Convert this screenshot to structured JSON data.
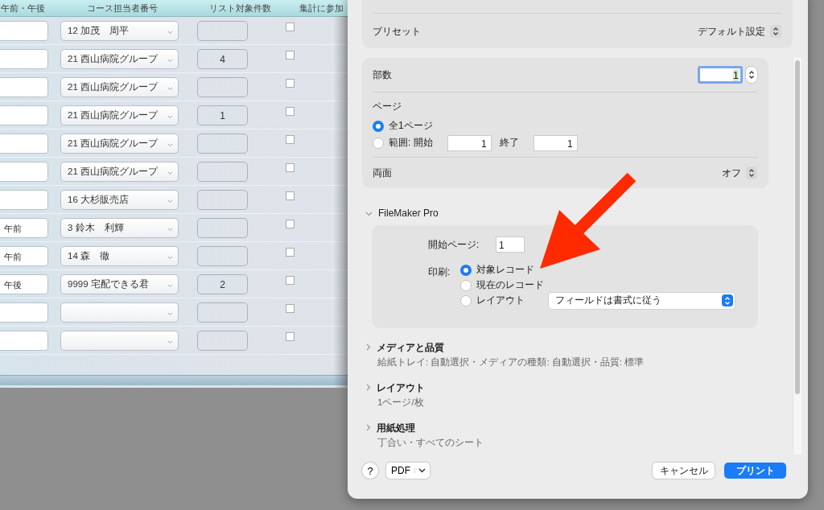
{
  "table": {
    "columns": [
      "午前・午後",
      "コース担当者番号",
      "リスト対象件数",
      "集計に参加"
    ],
    "rows": [
      {
        "course": "12 加茂　周平",
        "checked": false
      },
      {
        "course": "21 西山病院グループ",
        "count": "4",
        "checked": false
      },
      {
        "course": "21 西山病院グループ",
        "checked": false
      },
      {
        "course": "21 西山病院グループ",
        "count": "1",
        "checked": false
      },
      {
        "course": "21 西山病院グループ",
        "checked": false
      },
      {
        "course": "21 西山病院グループ",
        "checked": false
      },
      {
        "course": "16 大杉販売店",
        "checked": false
      },
      {
        "time": "午前",
        "course": "3 鈴木　利輝",
        "checked": false
      },
      {
        "time": "午前",
        "course": "14 森　徹",
        "checked": false
      },
      {
        "time": "午後",
        "course": "9999 宅配できる君",
        "count": "2",
        "checked": false
      },
      {
        "checked": false
      },
      {
        "checked": false
      }
    ]
  },
  "print_dialog": {
    "preset": {
      "label": "プリセット",
      "value": "デフォルト設定"
    },
    "copies": {
      "label": "部数",
      "value": "1"
    },
    "pages": {
      "label": "ページ",
      "options": [
        {
          "kind": "all",
          "label": "全1ページ",
          "selected": true
        },
        {
          "kind": "range",
          "label": "範囲: 開始",
          "from": "1",
          "to_label": "終了",
          "to": "1",
          "selected": false
        }
      ]
    },
    "duplex": {
      "label": "両面",
      "value": "オフ"
    },
    "filemaker": {
      "title": "FileMaker Pro",
      "expanded": true,
      "start_page_label": "開始ページ:",
      "start_page": "1",
      "print_label": "印刷:",
      "options": [
        {
          "label": "対象レコード",
          "selected": true
        },
        {
          "label": "現在のレコード",
          "selected": false
        },
        {
          "label": "レイアウト",
          "selected": false
        }
      ],
      "layout_dropdown": "フィールドは書式に従う"
    },
    "sections": [
      {
        "title": "メディアと品質",
        "summary": "給紙トレイ: 自動選択・メディアの種類: 自動選択・品質: 標準",
        "expanded": false
      },
      {
        "title": "レイアウト",
        "summary": "1ページ/枚",
        "expanded": false
      },
      {
        "title": "用紙処理",
        "summary": "丁合い・すべてのシート",
        "expanded": false
      }
    ],
    "help": "?",
    "pdf": "PDF",
    "buttons": [
      {
        "label": "キャンセル",
        "kind": "default"
      },
      {
        "label": "プリント",
        "kind": "primary"
      }
    ]
  }
}
